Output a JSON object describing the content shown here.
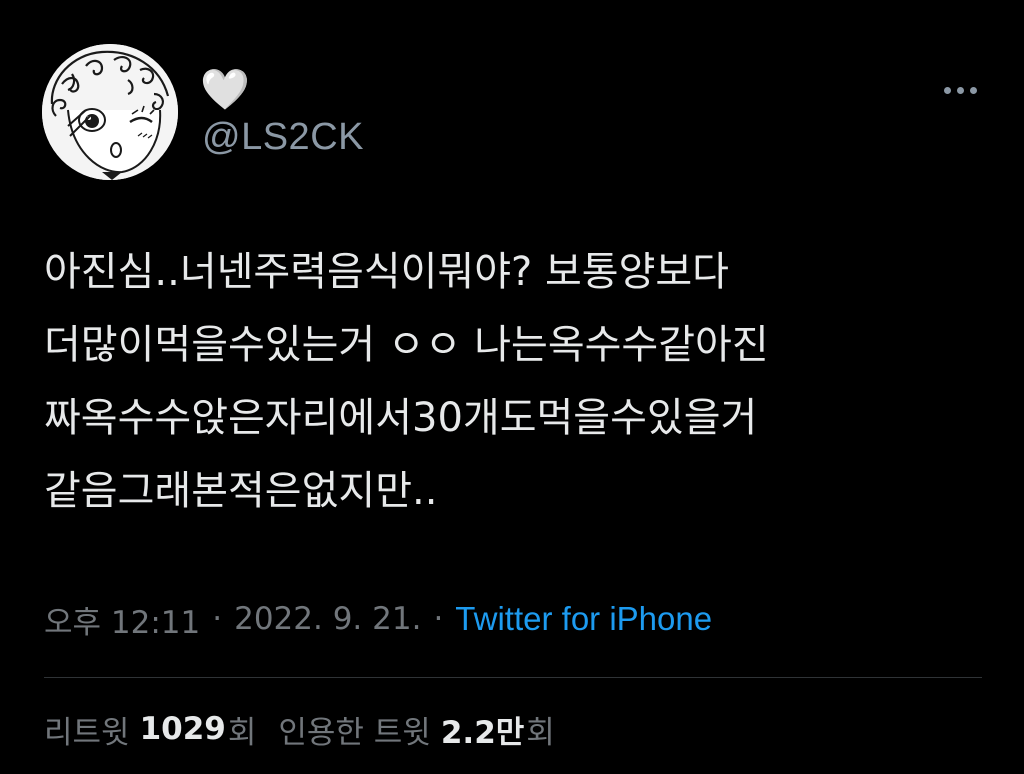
{
  "author": {
    "display_name": "🤍",
    "handle": "@LS2CK"
  },
  "tweet": {
    "lines": [
      "아진심..너넨주력음식이뭐야? 보통양보다",
      "더많이먹을수있는거 ㅇㅇ 나는옥수수같아진",
      "짜옥수수앉은자리에서30개도먹을수있을거",
      "같음그래본적은없지만.."
    ]
  },
  "meta": {
    "time": "오후 12:11",
    "separator": "·",
    "date": "2022. 9. 21.",
    "source": "Twitter for iPhone"
  },
  "stats": {
    "retweets_label": "리트윗",
    "retweets_count": "1029",
    "retweets_unit": "회",
    "quotes_label": "인용한 트윗",
    "quotes_count": "2.2만",
    "quotes_unit": "회"
  },
  "icons": {
    "more": "more-dots-icon",
    "avatar": "avatar-illustration"
  },
  "colors": {
    "background": "#000000",
    "text": "#e7e9ea",
    "secondary": "#71767b",
    "link": "#1d9bf0",
    "divider": "#2f3336"
  }
}
